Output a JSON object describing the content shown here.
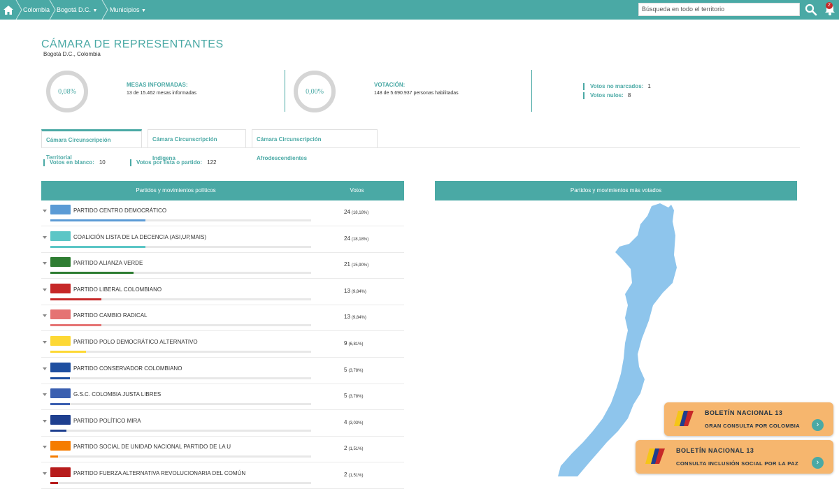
{
  "topbar": {
    "breadcrumbs": [
      "Colombia",
      "Bogotá D.C.",
      "Municipios"
    ],
    "search_placeholder": "Búsqueda en todo el territorio",
    "notification_count": "2",
    "accent": "#4aa9a5"
  },
  "header": {
    "title": "CÁMARA DE REPRESENTANTES",
    "subtitle": "Bogotá D.C., Colombia"
  },
  "stats": {
    "mesas": {
      "percent": "0,08%",
      "label": "MESAS INFORMADAS:",
      "detail": "13 de 15.462 mesas informadas"
    },
    "votacion": {
      "percent": "0,00%",
      "label": "VOTACIÓN:",
      "detail": "148 de 5.690.937 personas habilitadas"
    },
    "no_marcados": {
      "label": "Votos no marcados:",
      "value": "1"
    },
    "nulos": {
      "label": "Votos nulos:",
      "value": "8"
    }
  },
  "tabs": [
    {
      "label": "Cámara Circunscripción Territorial",
      "active": true
    },
    {
      "label": "Cámara Circunscripción Indígena",
      "active": false
    },
    {
      "label": "Cámara Circunscripción Afrodescendientes",
      "active": false
    }
  ],
  "summary": {
    "blanco": {
      "label": "Votos en blanco:",
      "value": "10"
    },
    "lista": {
      "label": "Votos por lista o partido:",
      "value": "122"
    }
  },
  "table": {
    "col_party": "Partidos y movimientos políticos",
    "col_votes": "Votos",
    "rows": [
      {
        "name": "PARTIDO CENTRO DEMOCRÁTICO",
        "votes": "24",
        "pct": "(18,18%)",
        "share": 0.1818,
        "color": "#5b9bd5"
      },
      {
        "name": "COALICIÓN LISTA DE LA DECENCIA (ASI,UP,MAIS)",
        "votes": "24",
        "pct": "(18,18%)",
        "share": 0.1818,
        "color": "#5cc6c6"
      },
      {
        "name": "PARTIDO ALIANZA VERDE",
        "votes": "21",
        "pct": "(15,90%)",
        "share": 0.159,
        "color": "#2e7d32"
      },
      {
        "name": "PARTIDO LIBERAL COLOMBIANO",
        "votes": "13",
        "pct": "(9,84%)",
        "share": 0.0984,
        "color": "#c62828"
      },
      {
        "name": "PARTIDO CAMBIO RADICAL",
        "votes": "13",
        "pct": "(9,84%)",
        "share": 0.0984,
        "color": "#e57373"
      },
      {
        "name": "PARTIDO POLO DEMOCRÁTICO ALTERNATIVO",
        "votes": "9",
        "pct": "(6,81%)",
        "share": 0.0681,
        "color": "#fdd835"
      },
      {
        "name": "PARTIDO CONSERVADOR COLOMBIANO",
        "votes": "5",
        "pct": "(3,78%)",
        "share": 0.0378,
        "color": "#1e4fa0"
      },
      {
        "name": "G.S.C. COLOMBIA JUSTA LIBRES",
        "votes": "5",
        "pct": "(3,78%)",
        "share": 0.0378,
        "color": "#3a5fb0"
      },
      {
        "name": "PARTIDO POLÍTICO MIRA",
        "votes": "4",
        "pct": "(3,03%)",
        "share": 0.0303,
        "color": "#1e3f8f"
      },
      {
        "name": "PARTIDO SOCIAL DE UNIDAD NACIONAL PARTIDO DE LA U",
        "votes": "2",
        "pct": "(1,51%)",
        "share": 0.0151,
        "color": "#f57c00"
      },
      {
        "name": "PARTIDO FUERZA ALTERNATIVA REVOLUCIONARIA DEL COMÚN",
        "votes": "2",
        "pct": "(1,51%)",
        "share": 0.0151,
        "color": "#b71c1c"
      }
    ]
  },
  "map_panel": {
    "title": "Partidos y movimientos más votados",
    "fill": "#8ec5ec"
  },
  "boletines": [
    {
      "title": "BOLETÍN NACIONAL 13",
      "subtitle": "GRAN CONSULTA POR COLOMBIA"
    },
    {
      "title": "BOLETÍN NACIONAL 13",
      "subtitle": "CONSULTA INCLUSIÓN SOCIAL POR LA PAZ"
    }
  ]
}
